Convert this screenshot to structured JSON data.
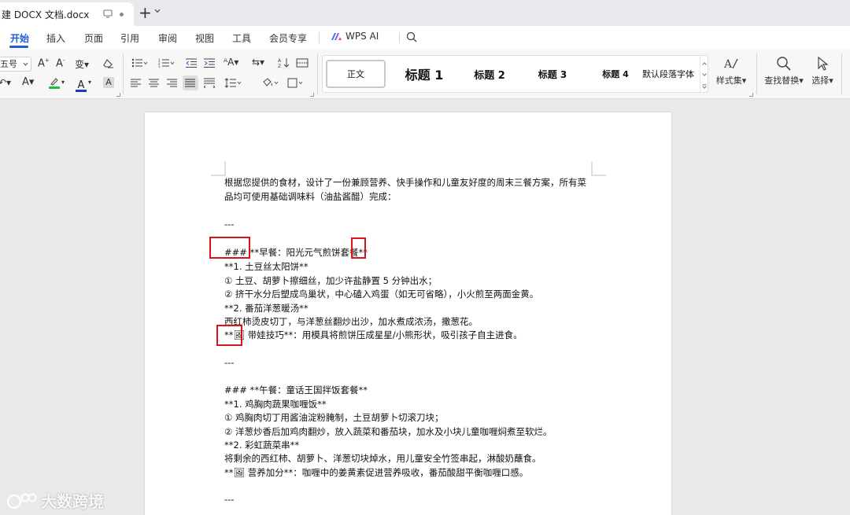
{
  "tabbar": {
    "doc_title": "建 DOCX 文档.docx",
    "add_label": "+"
  },
  "menu": {
    "items": [
      "开始",
      "插入",
      "页面",
      "引用",
      "审阅",
      "视图",
      "工具",
      "会员专享"
    ],
    "active_index": 0,
    "wps_ai": "WPS AI"
  },
  "ribbon": {
    "font_size_value": "五号",
    "styles": [
      "正文",
      "标题 1",
      "标题 2",
      "标题 3",
      "标题 4",
      "默认段落字体"
    ],
    "style_set": "样式集",
    "find_replace": "查找替换",
    "select": "选择"
  },
  "document": {
    "lines": [
      "根据您提供的食材，设计了一份兼顾营养、快手操作和儿童友好度的周末三餐方案，所有菜",
      "品均可使用基础调味料（油盐酱醋）完成：",
      "---",
      "### **早餐：阳光元气煎饼套餐**",
      "**1. 土豆丝太阳饼**",
      "① 土豆、胡萝卜擦细丝，加少许盐静置 5 分钟出水；",
      "② 挤干水分后塑成鸟巢状，中心磕入鸡蛋（如无可省略），小火煎至两面金黄。",
      "**2. 番茄洋葱暖汤**",
      "西红柿烫皮切丁，与洋葱丝翻炒出沙，加水煮成浓汤，撒葱花。",
      "**🖼 带娃技巧**：用模具将煎饼压成星星/小熊形状，吸引孩子自主进食。",
      "---",
      "### **午餐：童话王国拌饭套餐**",
      "**1. 鸡胸肉蔬果咖喱饭**",
      "① 鸡胸肉切丁用酱油淀粉腌制，土豆胡萝卜切滚刀块；",
      "② 洋葱炒香后加鸡肉翻炒，放入蔬菜和番茄块，加水及小块儿童咖喱焖煮至软烂。",
      "**2. 彩虹蔬菜串**",
      "将剩余的西红柿、胡萝卜、洋葱切块焯水，用儿童安全竹签串起，淋酸奶蘸食。",
      "**🖼 营养加分**：咖喱中的姜黄素促进营养吸收，番茄酸甜平衡咖喱口感。",
      "---"
    ]
  },
  "watermark": {
    "text": "大数跨境"
  },
  "colors": {
    "accent": "#1d5bd8",
    "highlight_box": "#d9131a",
    "page": "#ffffff",
    "workspace": "#e9e9ec"
  }
}
